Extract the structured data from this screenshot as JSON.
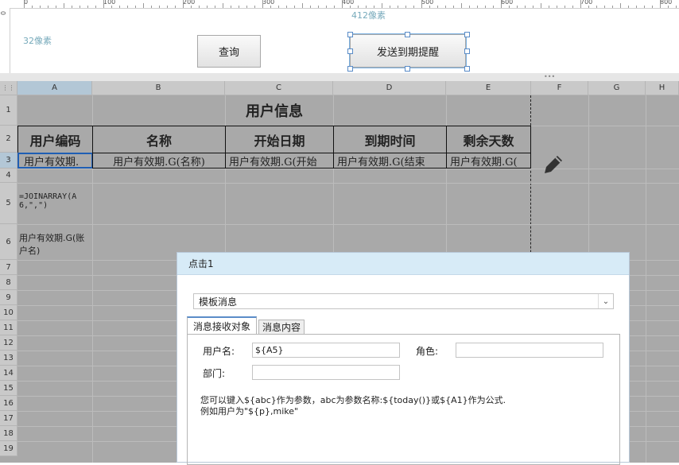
{
  "ruler": {
    "labels": [
      "0",
      "100",
      "200",
      "300",
      "400",
      "500",
      "600",
      "700",
      "800"
    ],
    "left_label": "0"
  },
  "canvas": {
    "width_label": "412像素",
    "height_label": "32像素"
  },
  "buttons": {
    "query": "查询",
    "send_reminder": "发送到期提醒"
  },
  "sheet": {
    "columns": [
      "A",
      "B",
      "C",
      "D",
      "E",
      "F",
      "G",
      "H"
    ],
    "rows": [
      "1",
      "2",
      "3",
      "4",
      "5",
      "6",
      "7",
      "8",
      "9",
      "10",
      "11",
      "12",
      "13",
      "14",
      "15",
      "16",
      "17",
      "18",
      "19"
    ],
    "title": "用户信息",
    "headers": [
      "用户编码",
      "名称",
      "开始日期",
      "到期时间",
      "剩余天数"
    ],
    "row3": [
      "用户有效期.",
      "用户有效期.G(名称)",
      "用户有效期.G(开始",
      "用户有效期.G(结束",
      "用户有效期.G("
    ],
    "a5": "=JOINARRAY(A6,\",\")",
    "a6": "用户有效期.G(账户名)"
  },
  "dialog": {
    "title": "点击1",
    "type_select": "模板消息",
    "tabs": [
      "消息接收对象",
      "消息内容"
    ],
    "username_label": "用户名:",
    "username_value": "${A5}",
    "role_label": "角色:",
    "role_value": "",
    "dept_label": "部门:",
    "dept_value": "",
    "hint_line1": "您可以键入${abc}作为参数，abc为参数名称:${today()}或${A1}作为公式.",
    "hint_line2": "例如用户为\"${p},mike\""
  },
  "colors": {
    "accent": "#5a8cc8",
    "dialog_header": "#d7ebf7",
    "sheet_bg": "#a9a9a9"
  }
}
